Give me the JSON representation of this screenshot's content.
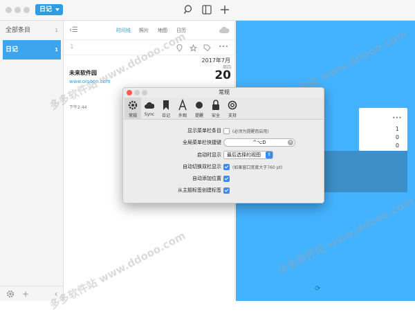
{
  "toolbar": {
    "journal": "日记"
  },
  "sidebar": {
    "items": [
      {
        "label": "全部条目",
        "count": "1"
      },
      {
        "label": "日记",
        "count": "1"
      }
    ]
  },
  "list": {
    "tabs": [
      "时间线",
      "照片",
      "地图",
      "日历"
    ],
    "entry_count": "1",
    "month": "2017年7月",
    "entry": {
      "title": "未来软件园",
      "url": "www.orsoon.com",
      "weekday": "周四",
      "day": "20",
      "time": "下午2:44"
    }
  },
  "detail": {
    "card_dots": "•••",
    "card_values": [
      "1",
      "0",
      "0"
    ]
  },
  "watermark": "多多软件站 www.ddooo.com",
  "dialog": {
    "title": "常规",
    "tabs": [
      {
        "label": "常规",
        "icon": "gear-icon"
      },
      {
        "label": "Sync",
        "icon": "cloud-icon"
      },
      {
        "label": "日记",
        "icon": "bookmark-icon"
      },
      {
        "label": "外观",
        "icon": "font-icon"
      },
      {
        "label": "提醒",
        "icon": "bell-icon"
      },
      {
        "label": "安全",
        "icon": "lock-icon"
      },
      {
        "label": "支持",
        "icon": "lifebuoy-icon"
      }
    ],
    "rows": {
      "menubar_label": "显示菜单栏条目",
      "menubar_hint": "(必须为提醒而启用)",
      "shortcut_label": "全局菜单栏快捷键",
      "shortcut_value": "^⌥D",
      "startup_label": "启动时显示",
      "startup_value": "最后选择的视图",
      "autosplit_label": "自动切换双栏显示",
      "autosplit_hint": "(如果窗口宽度大于760 pt)",
      "location_label": "自动添加位置",
      "tags_label": "从主题标签创建标签"
    },
    "checks": {
      "menubar": false,
      "autosplit": true,
      "location": true,
      "tags": true
    }
  }
}
